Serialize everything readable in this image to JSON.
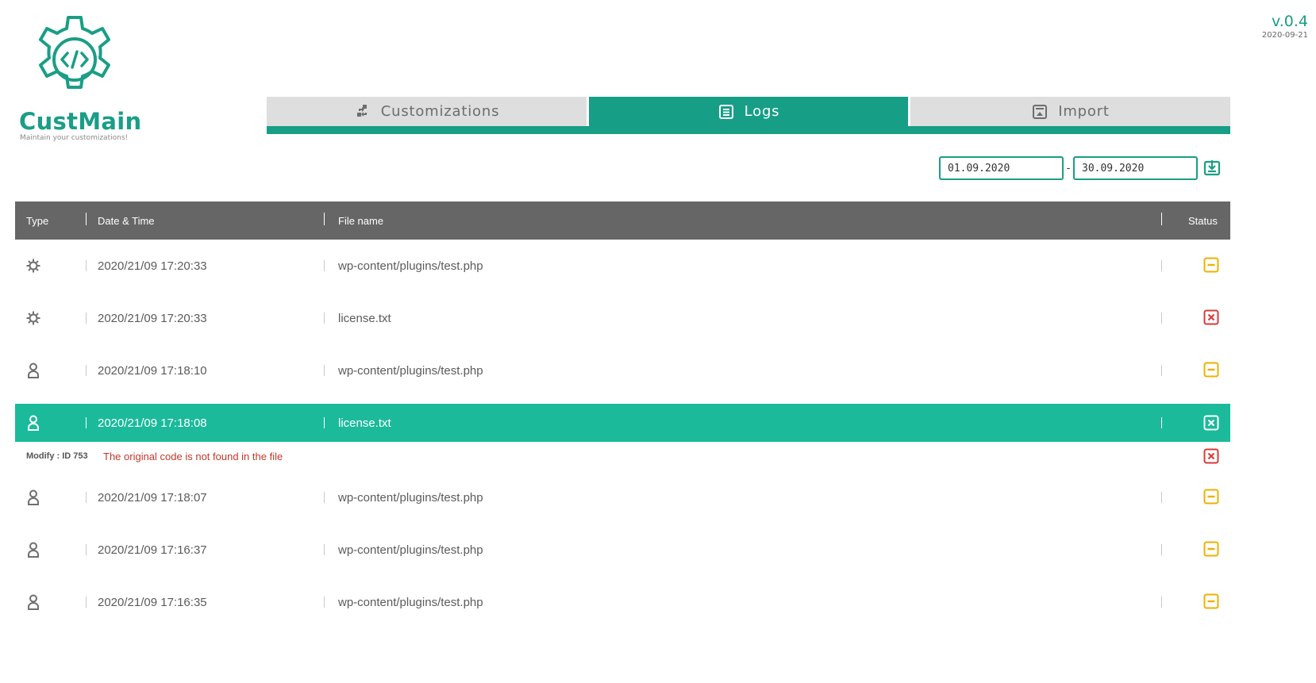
{
  "app": {
    "name": "CustMain",
    "tagline": "Maintain your customizations!",
    "version": "v.0.4",
    "version_date": "2020-09-21"
  },
  "tabs": [
    {
      "label": "Customizations",
      "icon": "transfer-icon",
      "active": false
    },
    {
      "label": "Logs",
      "icon": "list-icon",
      "active": true
    },
    {
      "label": "Import",
      "icon": "import-icon",
      "active": false
    }
  ],
  "date_range": {
    "from": "01.09.2020",
    "separator": "-",
    "to": "30.09.2020",
    "export_icon": "download-icon"
  },
  "table": {
    "columns": {
      "type": "Type",
      "datetime": "Date & Time",
      "file": "File name",
      "status": "Status"
    },
    "rows": [
      {
        "type": "gear",
        "datetime": "2020/21/09 17:20:33",
        "file": "wp-content/plugins/test.php",
        "status": "warning"
      },
      {
        "type": "gear",
        "datetime": "2020/21/09 17:20:33",
        "file": "license.txt",
        "status": "error"
      },
      {
        "type": "user",
        "datetime": "2020/21/09 17:18:10",
        "file": "wp-content/plugins/test.php",
        "status": "warning"
      },
      {
        "type": "user",
        "datetime": "2020/21/09 17:18:08",
        "file": "license.txt",
        "status": "error",
        "selected": true
      },
      {
        "type": "user",
        "datetime": "2020/21/09 17:18:07",
        "file": "wp-content/plugins/test.php",
        "status": "warning"
      },
      {
        "type": "user",
        "datetime": "2020/21/09 17:16:37",
        "file": "wp-content/plugins/test.php",
        "status": "warning"
      },
      {
        "type": "user",
        "datetime": "2020/21/09 17:16:35",
        "file": "wp-content/plugins/test.php",
        "status": "warning"
      }
    ],
    "detail": {
      "label": "Modify : ID 753",
      "message": "The original code is not found in the file",
      "status": "error"
    }
  },
  "colors": {
    "accent": "#1a9e86",
    "selected_row": "#1bba9b",
    "header_bg": "#666666",
    "warning": "#f0b000",
    "error": "#d93a3a"
  }
}
